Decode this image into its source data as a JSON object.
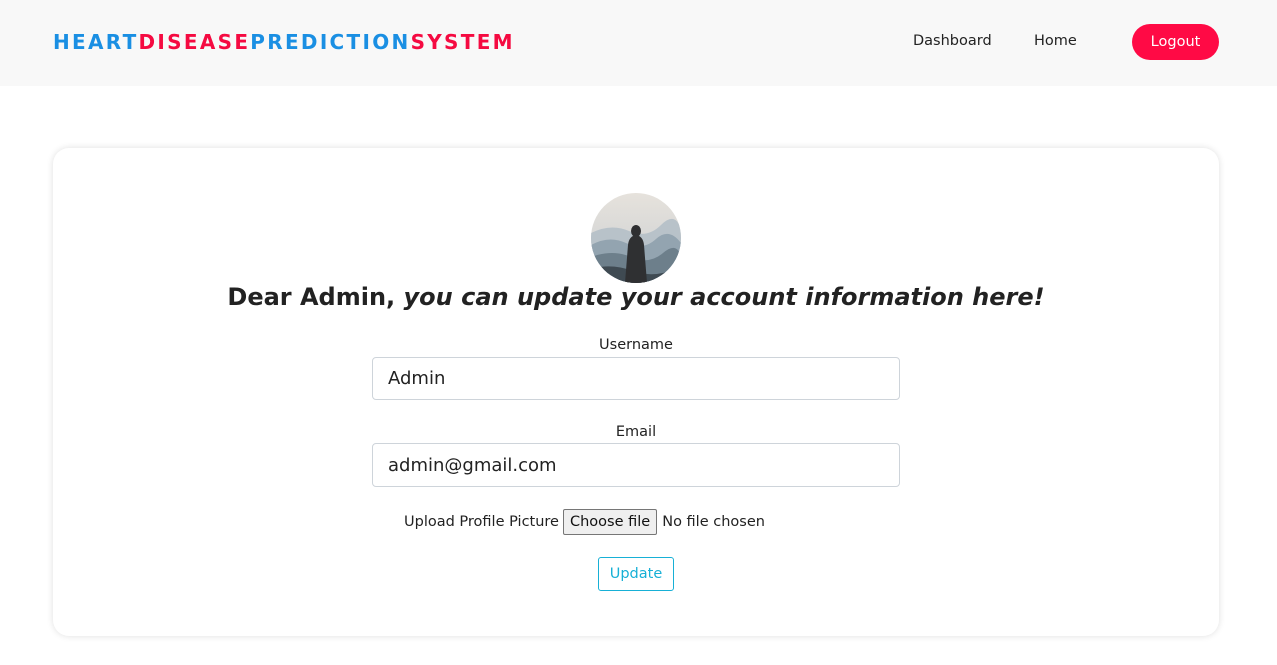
{
  "colors": {
    "brand_blue": "#1a8fe3",
    "brand_red": "#f50a41",
    "logout_bg": "#ff0a45",
    "update_accent": "#17b0d6",
    "navbar_bg": "#f8f8f8"
  },
  "navbar": {
    "brand_parts": [
      {
        "text": "HEART",
        "color": "blue"
      },
      {
        "text": "DISEASE",
        "color": "red"
      },
      {
        "text": "PREDICTION",
        "color": "blue"
      },
      {
        "text": "SYSTEM",
        "color": "red"
      }
    ],
    "links": {
      "dashboard": "Dashboard",
      "home": "Home"
    },
    "logout_label": "Logout"
  },
  "profile": {
    "avatar_icon": "avatar-icon",
    "greeting_name": "Dear Admin,",
    "greeting_message": "you can update your account information here!",
    "username_label": "Username",
    "username_value": "Admin",
    "email_label": "Email",
    "email_value": "admin@gmail.com",
    "upload_label": "Upload Profile Picture",
    "choose_file_label": "Choose file",
    "no_file_text": "No file chosen",
    "update_label": "Update"
  }
}
